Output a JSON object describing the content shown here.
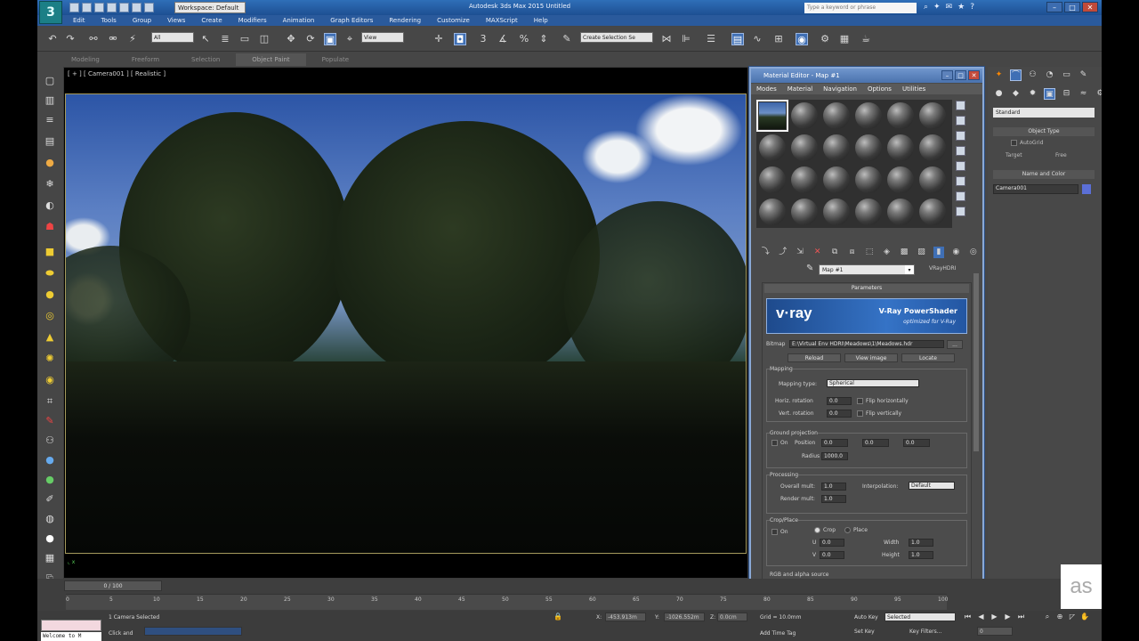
{
  "app": {
    "workspace": "Workspace: Default",
    "title": "Autodesk 3ds Max 2015    Untitled",
    "search_placeholder": "Type a keyword or phrase"
  },
  "menus": [
    "Edit",
    "Tools",
    "Group",
    "Views",
    "Create",
    "Modifiers",
    "Animation",
    "Graph Editors",
    "Rendering",
    "Customize",
    "MAXScript",
    "Help"
  ],
  "toolbar": {
    "selection_filter": "All",
    "ref_coord": "View",
    "named_sel_placeholder": "Create Selection Se"
  },
  "ribbon_tabs": [
    "Modeling",
    "Freeform",
    "Selection",
    "Object Paint",
    "Populate"
  ],
  "viewport": {
    "label": "[ + ] [ Camera001 ] [ Realistic ]"
  },
  "material_editor": {
    "title": "Material Editor - Map #1",
    "menus": [
      "Modes",
      "Material",
      "Navigation",
      "Options",
      "Utilities"
    ],
    "map_name": "Map #1",
    "map_type": "VRayHDRI",
    "rollout": "Parameters",
    "logo": {
      "brand": "v·ray",
      "product": "V-Ray PowerShader",
      "tagline": "optimized for V-Ray"
    },
    "bitmap_label": "Bitmap",
    "bitmap_path": "E:\\Virtual Env HDRI\\Meadows\\1\\Meadows.hdr",
    "bitmap_browse": "...",
    "buttons": [
      "Reload",
      "View image",
      "Locate"
    ],
    "mapping": {
      "group": "Mapping",
      "type_label": "Mapping type:",
      "type_value": "Spherical",
      "horiz_rot_label": "Horiz. rotation",
      "horiz_rot": "0.0",
      "flip_h": "Flip horizontally",
      "vert_rot_label": "Vert. rotation",
      "vert_rot": "0.0",
      "flip_v": "Flip vertically"
    },
    "ground": {
      "group": "Ground projection",
      "on_label": "On",
      "position_label": "Position",
      "pos": [
        "0.0",
        "0.0",
        "0.0"
      ],
      "radius_label": "Radius",
      "radius": "1000.0"
    },
    "processing": {
      "group": "Processing",
      "overall_label": "Overall mult:",
      "overall": "1.0",
      "render_label": "Render mult:",
      "render": "1.0",
      "interp_label": "Interpolation:",
      "interp": "Default"
    },
    "crop": {
      "group": "Crop/Place",
      "on_label": "On",
      "crop_label": "Crop",
      "place_label": "Place",
      "u_label": "U",
      "u": "0.0",
      "v_label": "V",
      "v": "0.0",
      "w_label": "Width",
      "w": "1.0",
      "h_label": "Height",
      "h": "1.0"
    },
    "rgb_group": "RGB and alpha source"
  },
  "command_panel": {
    "dropdown": "Standard",
    "object_type": "Object Type",
    "autogrid": "AutoGrid",
    "target": "Target",
    "free": "Free",
    "name_color": "Name and Color",
    "name": "Camera001",
    "name_color_hex": "#5b6fd6"
  },
  "timeline": {
    "slider": "0 / 100",
    "ticks": [
      "0",
      "5",
      "10",
      "15",
      "20",
      "25",
      "30",
      "35",
      "40",
      "45",
      "50",
      "55",
      "60",
      "65",
      "70",
      "75",
      "80",
      "85",
      "90",
      "95",
      "100"
    ]
  },
  "status": {
    "maxscript": "Welcome to M",
    "selected": "1 Camera Selected",
    "prompt": "Click and",
    "x_label": "X:",
    "x": "-453.913m",
    "y_label": "Y:",
    "y": "-1026.552m",
    "z_label": "Z:",
    "z": "0.0cm",
    "grid": "Grid = 10.0mm",
    "auto_key": "Auto Key",
    "set_key": "Set Key",
    "key_mode": "Selected",
    "key_filters": "Key Filters...",
    "add_time_tag": "Add Time Tag",
    "frame": "0"
  },
  "watermark": "as"
}
